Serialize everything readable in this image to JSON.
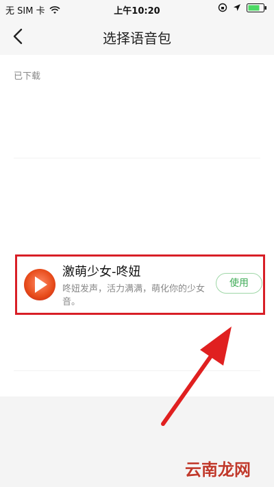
{
  "status_bar": {
    "carrier": "无 SIM 卡",
    "time": "上午10:20",
    "icons": [
      "wifi-icon",
      "orientation-lock-icon",
      "location-icon",
      "battery-icon"
    ]
  },
  "nav": {
    "title": "选择语音包",
    "back_icon": "chevron-left-icon"
  },
  "section": {
    "label": "已下载"
  },
  "voice_pack": {
    "name": "激萌少女-咚妞",
    "description": "咚妞发声，活力满满，萌化你的少女音。",
    "use_label": "使用",
    "avatar_icon": "play-icon"
  },
  "watermark": "云南龙网",
  "colors": {
    "highlight_border": "#d81e26",
    "use_button": "#3daa55",
    "arrow": "#e02020"
  }
}
